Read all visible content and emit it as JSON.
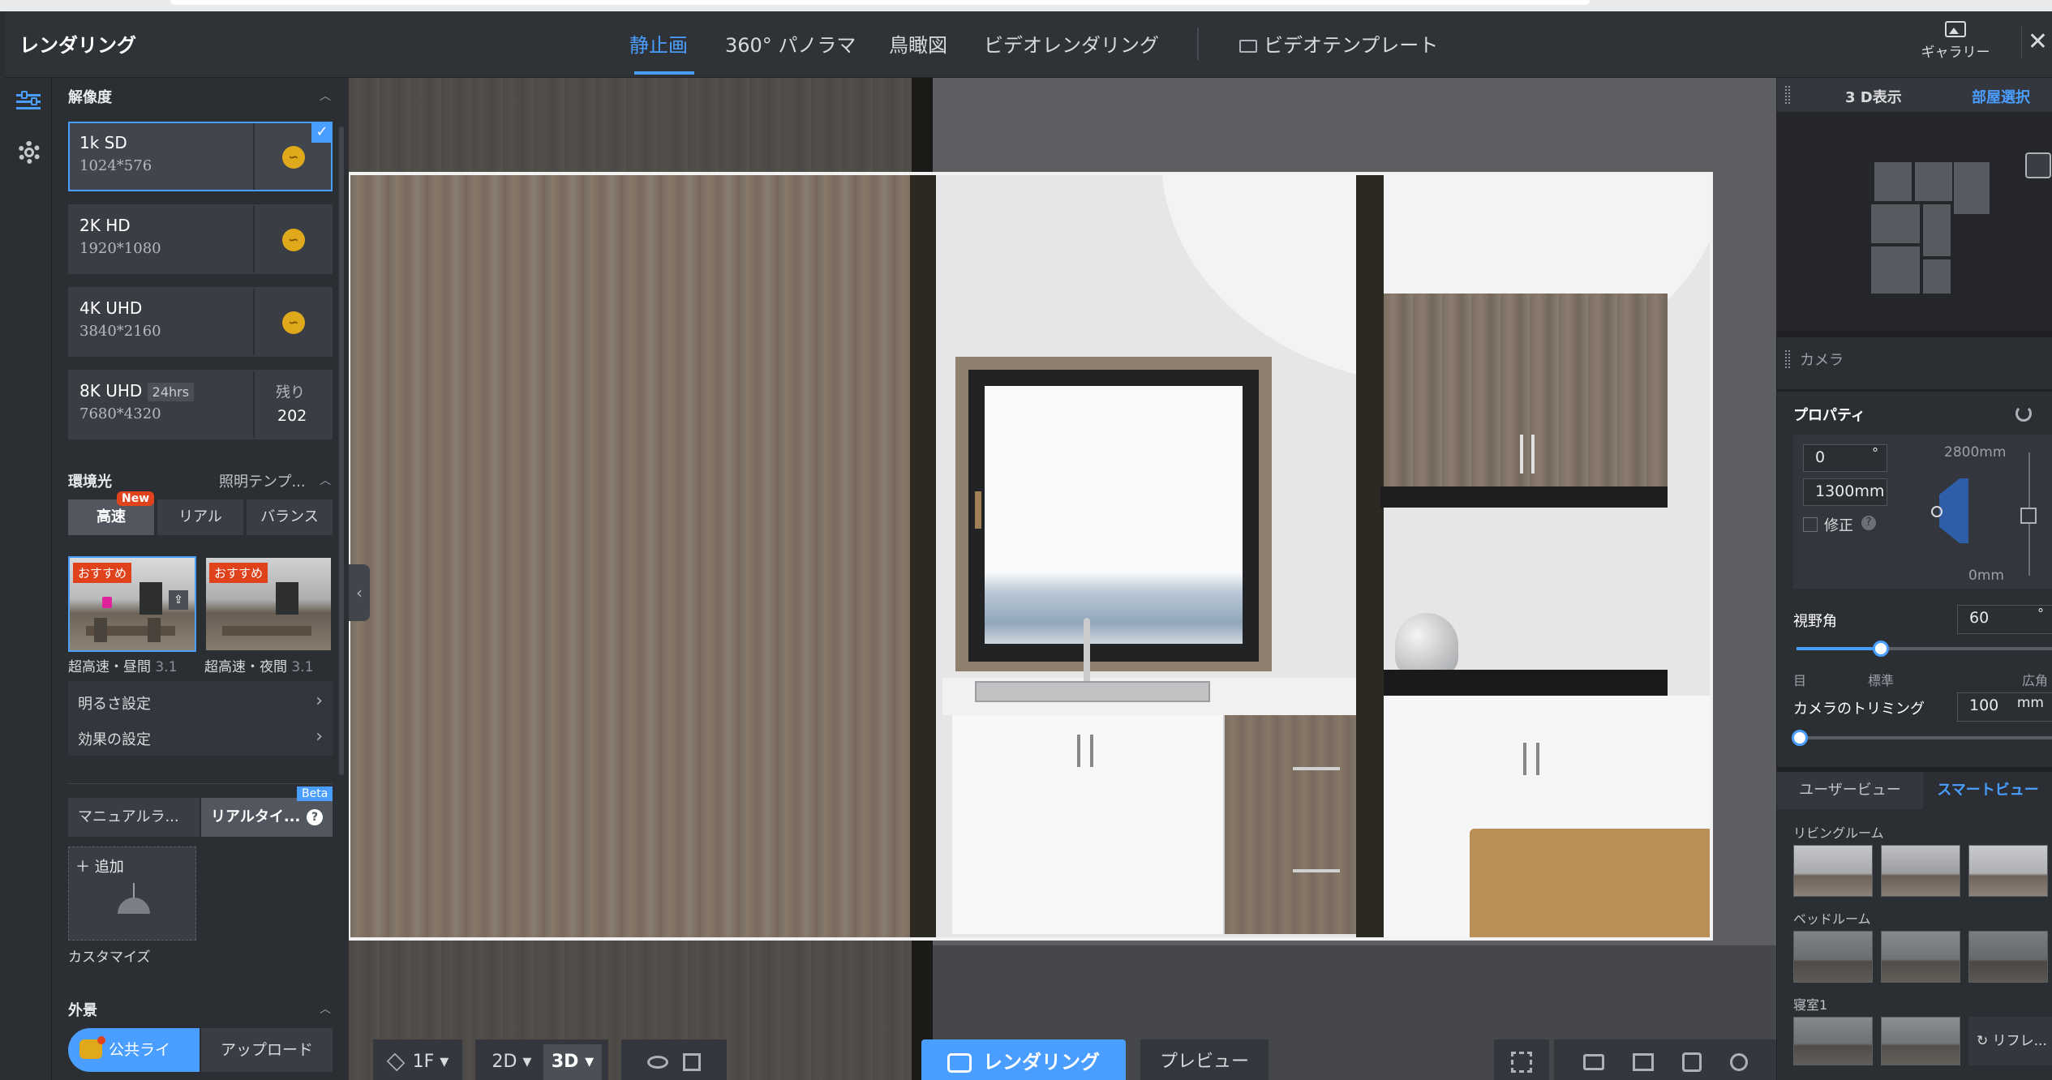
{
  "header": {
    "title": "レンダリング",
    "tabs": [
      "静止画",
      "360° パノラマ",
      "鳥瞰図",
      "ビデオレンダリング"
    ],
    "video_template": "ビデオテンプレート",
    "gallery": "ギャラリー",
    "close": "✕"
  },
  "left": {
    "resolution_title": "解像度",
    "resolutions": [
      {
        "name": "1k SD",
        "dims": "1024*576"
      },
      {
        "name": "2K HD",
        "dims": "1920*1080"
      },
      {
        "name": "4K UHD",
        "dims": "3840*2160"
      },
      {
        "name": "8K UHD",
        "badge": "24hrs",
        "dims": "7680*4320",
        "remaining_label": "残り",
        "remaining": "202"
      }
    ],
    "env_title": "環境光",
    "env_template": "照明テンプ...",
    "env_modes": [
      "高速",
      "リアル",
      "バランス"
    ],
    "new_badge": "New",
    "thumbs": [
      {
        "tag": "おすすめ",
        "name": "超高速・昼間",
        "ver": "3.1"
      },
      {
        "tag": "おすすめ",
        "name": "超高速・夜間",
        "ver": "3.1"
      }
    ],
    "brightness": "明るさ設定",
    "effects": "効果の設定",
    "light_tabs": [
      "マニュアルラ...",
      "リアルタイ..."
    ],
    "beta_badge": "Beta",
    "add": "追加",
    "customize": "カスタマイズ",
    "exterior_title": "外景",
    "public_library": "公共ライブ...",
    "upload": "アップロード"
  },
  "canvas_toolbar": {
    "floor": "1F",
    "view2d": "2D",
    "view3d": "3D",
    "render": "レンダリング",
    "preview": "プレビュー"
  },
  "right": {
    "tabs": [
      "3 D表示",
      "部屋選択"
    ],
    "camera": "カメラ",
    "properties": "プロパティ",
    "angle": "0",
    "angle_unit": "°",
    "height": "1300mm",
    "max_height": "2800mm",
    "min_height": "0mm",
    "correction": "修正",
    "fov_label": "視野角",
    "fov_value": "60",
    "fov_unit": "°",
    "fov_ticks": [
      "目",
      "標準",
      "広角"
    ],
    "fov_value_fraction": 0.33,
    "crop_label": "カメラのトリミング",
    "crop_value": "100",
    "crop_unit": "mm",
    "crop_value_fraction": 0.0,
    "view_tabs": [
      "ユーザービュー",
      "スマートビュー"
    ],
    "rooms": [
      "リビングルーム",
      "ベッドルーム",
      "寝室1"
    ],
    "reflect": "リフレ..."
  },
  "colors": {
    "accent": "#4a9eff",
    "coin": "#e0a91c",
    "recommend": "#e0421b"
  }
}
